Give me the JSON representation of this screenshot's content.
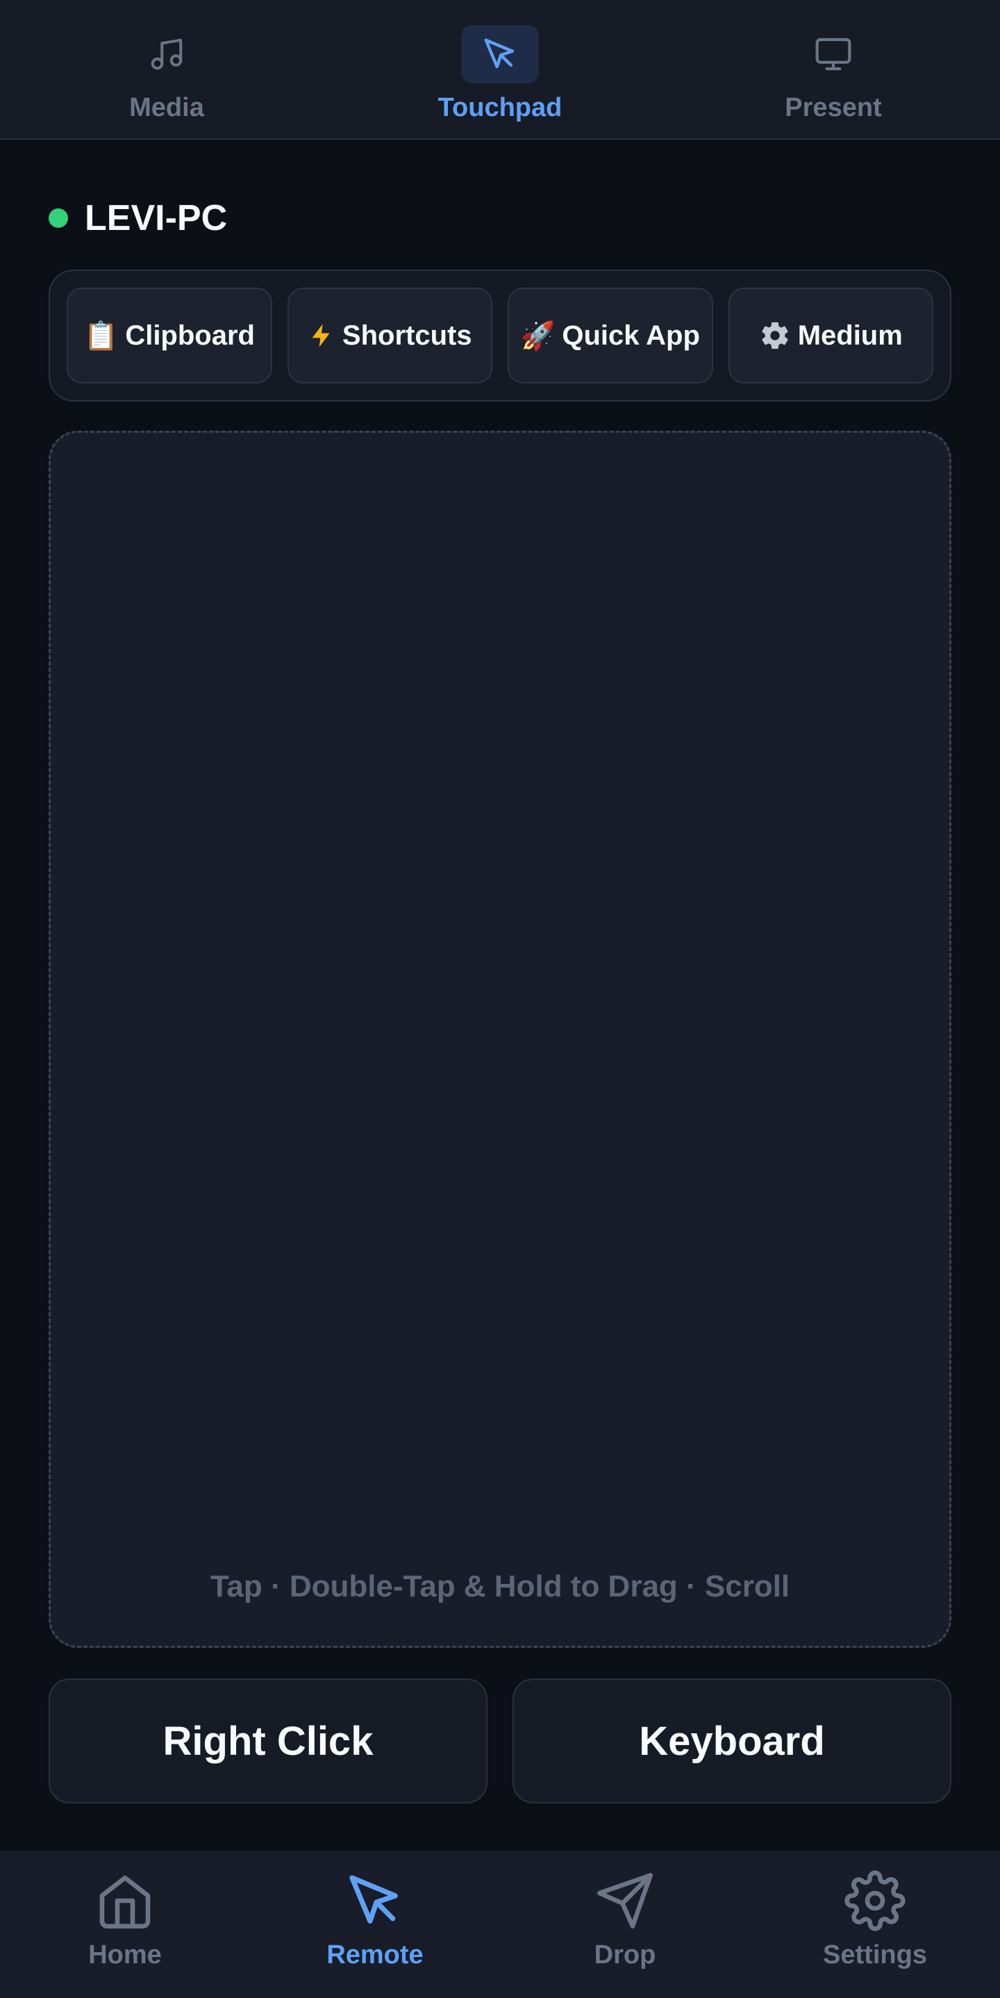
{
  "top_tabs": [
    {
      "label": "Media",
      "icon": "music-icon",
      "active": false
    },
    {
      "label": "Touchpad",
      "icon": "cursor-icon",
      "active": true
    },
    {
      "label": "Present",
      "icon": "monitor-icon",
      "active": false
    }
  ],
  "device": {
    "name": "LEVI-PC",
    "status_color": "#34d17a"
  },
  "chips": [
    {
      "label": "Clipboard",
      "icon": "clipboard-icon",
      "emoji": "📋"
    },
    {
      "label": "Shortcuts",
      "icon": "lightning-icon",
      "emoji": "⚡"
    },
    {
      "label": "Quick App",
      "icon": "rocket-icon",
      "emoji": "🚀"
    },
    {
      "label": "Medium",
      "icon": "gear-icon",
      "emoji": "⚙️"
    }
  ],
  "touchpad": {
    "hint": "Tap · Double-Tap & Hold to Drag · Scroll"
  },
  "actions": {
    "right_click": "Right Click",
    "keyboard": "Keyboard"
  },
  "bottom_nav": [
    {
      "label": "Home",
      "icon": "home-icon",
      "active": false
    },
    {
      "label": "Remote",
      "icon": "cursor-icon",
      "active": true
    },
    {
      "label": "Drop",
      "icon": "send-icon",
      "active": false
    },
    {
      "label": "Settings",
      "icon": "settings-icon",
      "active": false
    }
  ],
  "colors": {
    "accent": "#5fa0f5",
    "inactive": "#6b7586",
    "background": "#0c0f16",
    "surface": "#161b26"
  }
}
